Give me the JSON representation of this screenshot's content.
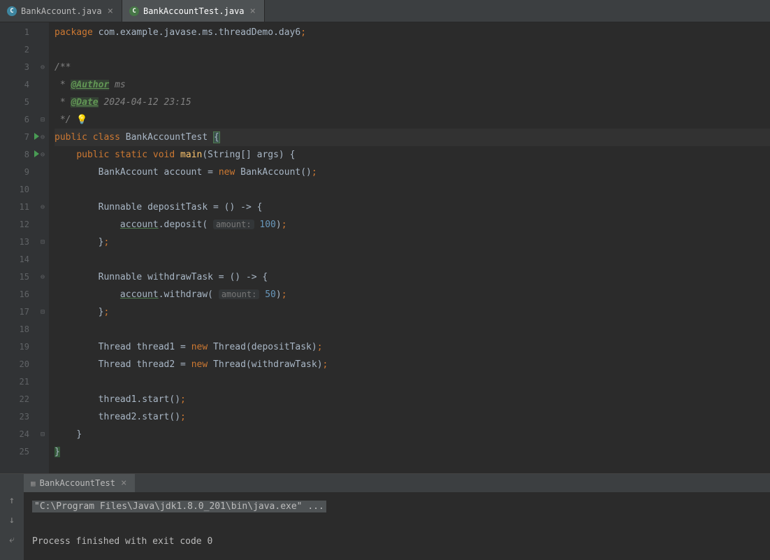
{
  "tabs": [
    {
      "icon": "C",
      "label": "BankAccount.java",
      "active": false
    },
    {
      "icon": "C",
      "label": "BankAccountTest.java",
      "active": true
    }
  ],
  "runTab": {
    "label": "BankAccountTest"
  },
  "console": {
    "cmd": "\"C:\\Program Files\\Java\\jdk1.8.0_201\\bin\\java.exe\" ...",
    "exit": "Process finished with exit code 0"
  },
  "code": {
    "l1": {
      "kw": "package",
      "rest": " com.example.javase.ms.threadDemo.day6",
      "semi": ";"
    },
    "l3": "/**",
    "l4_star": " * ",
    "l4_ann": "@Author",
    "l4_rest": " ms",
    "l5_star": " * ",
    "l5_ann": "@Date",
    "l5_rest": " 2024-04-12 23:15",
    "l6": " */",
    "l7_kw1": "public",
    "l7_kw2": "class",
    "l7_cls": " BankAccountTest ",
    "l8_kw1": "public",
    "l8_kw2": "static",
    "l8_kw3": "void",
    "l8_mth": "main",
    "l8_rest": "(String[] args) {",
    "l9_a": "BankAccount account = ",
    "l9_kw": "new",
    "l9_b": " BankAccount()",
    "l9_semi": ";",
    "l11_a": "Runnable depositTask = () -> {",
    "l12_var": "account",
    "l12_b": ".deposit(",
    "l12_hint": "amount:",
    "l12_num": " 100",
    "l12_c": ")",
    "l12_semi": ";",
    "l13_a": "}",
    "l13_semi": ";",
    "l15_a": "Runnable withdrawTask = () -> {",
    "l16_var": "account",
    "l16_b": ".withdraw(",
    "l16_hint": "amount:",
    "l16_num": " 50",
    "l16_c": ")",
    "l16_semi": ";",
    "l17_a": "}",
    "l17_semi": ";",
    "l19_a": "Thread thread1 = ",
    "l19_kw": "new",
    "l19_b": " Thread(depositTask)",
    "l19_semi": ";",
    "l20_a": "Thread thread2 = ",
    "l20_kw": "new",
    "l20_b": " Thread(withdrawTask)",
    "l20_semi": ";",
    "l22_a": "thread1.start()",
    "l22_semi": ";",
    "l23_a": "thread2.start()",
    "l23_semi": ";",
    "l24": "}",
    "l25": "}"
  },
  "lineNumbers": [
    "1",
    "2",
    "3",
    "4",
    "5",
    "6",
    "7",
    "8",
    "9",
    "10",
    "11",
    "12",
    "13",
    "14",
    "15",
    "16",
    "17",
    "18",
    "19",
    "20",
    "21",
    "22",
    "23",
    "24",
    "25"
  ]
}
